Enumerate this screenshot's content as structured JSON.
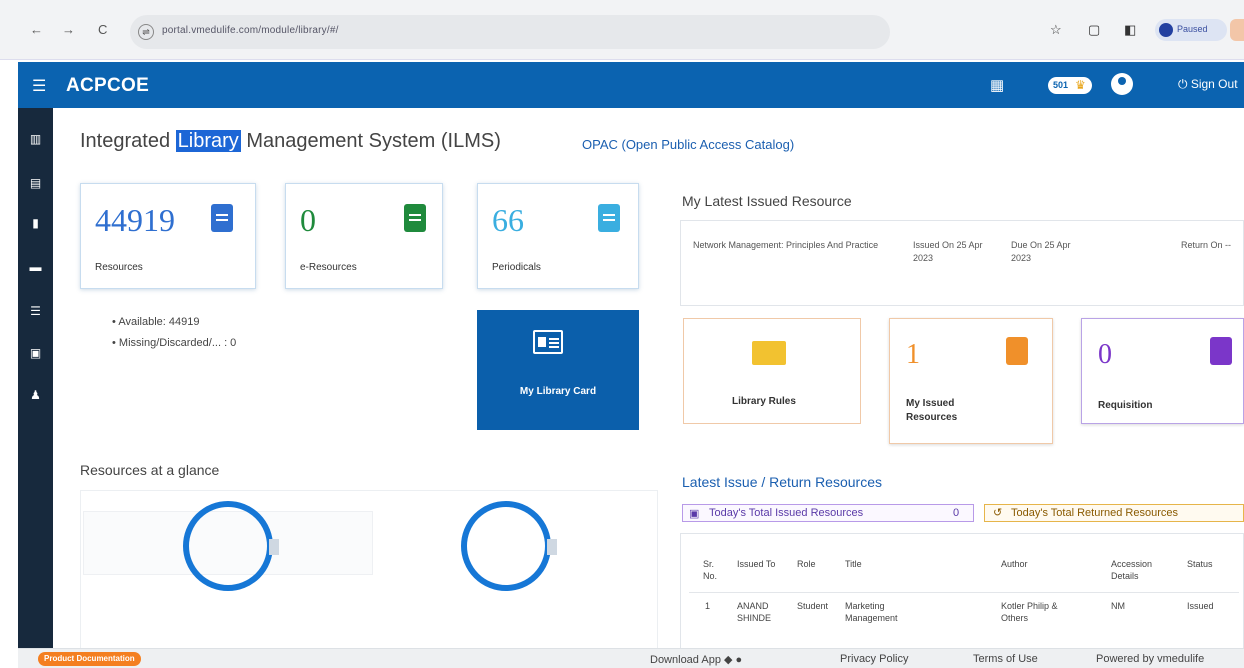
{
  "browser": {
    "url": "portal.vmedulife.com/module/library/#/"
  },
  "app": {
    "title": "ACPCOE",
    "badge_count": "501",
    "sign_out": "Sign Out"
  },
  "page": {
    "title_pre": "Integrated ",
    "title_highlight": "Library",
    "title_post": " Management System (ILMS)",
    "opac_link": "OPAC (Open Public Access Catalog)"
  },
  "stats": [
    {
      "value": "44919",
      "label": "Resources",
      "color": "#2f6fd0"
    },
    {
      "value": "0",
      "label": "e-Resources",
      "color": "#1f8a3c"
    },
    {
      "value": "66",
      "label": "Periodicals",
      "color": "#3aaee0"
    }
  ],
  "availability": {
    "available": "Available: 44919",
    "missing": "Missing/Discarded/... : 0"
  },
  "library_card": {
    "label": "My Library Card"
  },
  "latest_issued": {
    "title": "My Latest Issued Resource",
    "resource": "Network Management: Principles And Practice",
    "issued_on": "Issued On 25 Apr 2023",
    "due_on": "Due On 25 Apr 2023",
    "return_on": "Return On --"
  },
  "tiles": {
    "rules": "Library Rules",
    "issued_count": "1",
    "issued_label_1": "My Issued",
    "issued_label_2": "Resources",
    "requisition_count": "0",
    "requisition_label": "Requisition"
  },
  "glance": {
    "title": "Resources at a glance"
  },
  "issue_return": {
    "title": "Latest Issue / Return Resources",
    "issued_pill": "Today's Total Issued Resources",
    "issued_count": "0",
    "returned_pill": "Today's Total Returned Resources",
    "headers": [
      "Sr. No.",
      "Issued To",
      "Role",
      "Title",
      "Author",
      "Accession Details",
      "Status"
    ],
    "row": [
      "1",
      "ANAND SHINDE",
      "Student",
      "Marketing Management",
      "Kotler Philip & Others",
      "NM",
      "Issued"
    ]
  },
  "footer": {
    "doc": "Product Documentation",
    "download": "Download App",
    "privacy": "Privacy Policy",
    "terms": "Terms of Use",
    "powered": "Powered by vmedulife"
  },
  "colors": {
    "header": "#0b63b0",
    "sidebar": "#17293d",
    "rules_icon": "#f2c230",
    "issued_icon": "#f0902a",
    "requisition_icon": "#7b36c9"
  }
}
